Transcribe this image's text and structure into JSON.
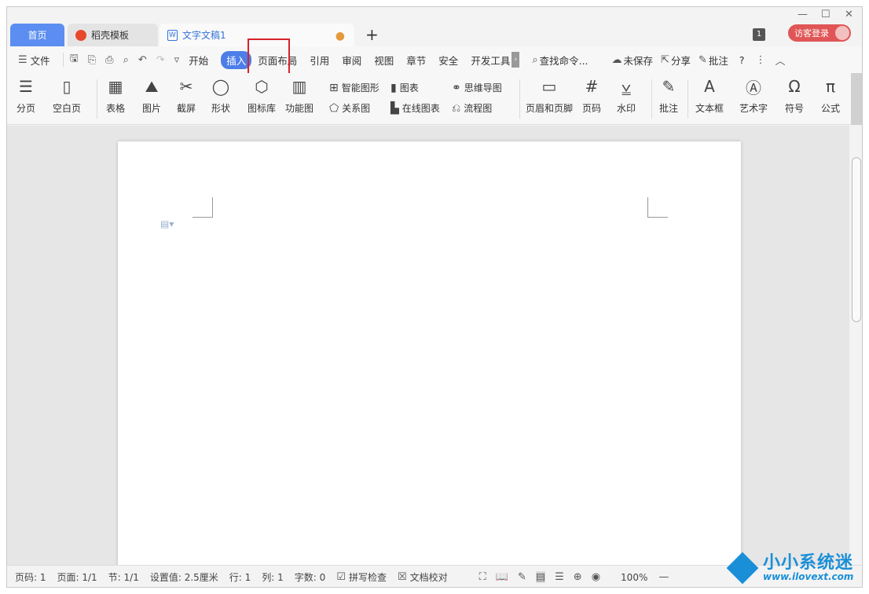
{
  "tabs": {
    "home": "首页",
    "docer": "稻壳模板",
    "doc": "文字文稿1",
    "doc_dot": "●",
    "plus": "+"
  },
  "window": {
    "badge": "1",
    "login": "访客登录",
    "min": "—",
    "max": "☐",
    "close": "✕"
  },
  "menu": {
    "file": "文件",
    "items": [
      "开始",
      "插入",
      "页面布局",
      "引用",
      "审阅",
      "视图",
      "章节",
      "安全",
      "开发工具"
    ],
    "search": "查找命令...",
    "unsaved": "未保存",
    "share": "分享",
    "comment": "批注",
    "help": "?"
  },
  "ribbon": {
    "big1": [
      "分页",
      "空白页"
    ],
    "big2": [
      "表格",
      "图片",
      "截屏",
      "形状",
      "图标库",
      "功能图"
    ],
    "smartart": "智能图形",
    "chart": "图表",
    "mindmap": "思维导图",
    "relation": "关系图",
    "online_chart": "在线图表",
    "flowchart": "流程图",
    "big3": [
      "页眉和页脚",
      "页码",
      "水印"
    ],
    "big4": [
      "批注"
    ],
    "big5": [
      "文本框",
      "艺术字",
      "符号",
      "公式"
    ]
  },
  "status": {
    "page_no": "页码: 1",
    "pages": "页面: 1/1",
    "section": "节: 1/1",
    "setting": "设置值: 2.5厘米",
    "row": "行: 1",
    "col": "列: 1",
    "words": "字数: 0",
    "spell": "拼写检查",
    "proof": "文档校对",
    "zoom": "100%"
  },
  "watermark": {
    "title": "小小系统迷",
    "url": "www.ilovext.com"
  },
  "colors": {
    "accent": "#4d7ee8",
    "highlight": "#d8232a",
    "login": "#e05656"
  }
}
